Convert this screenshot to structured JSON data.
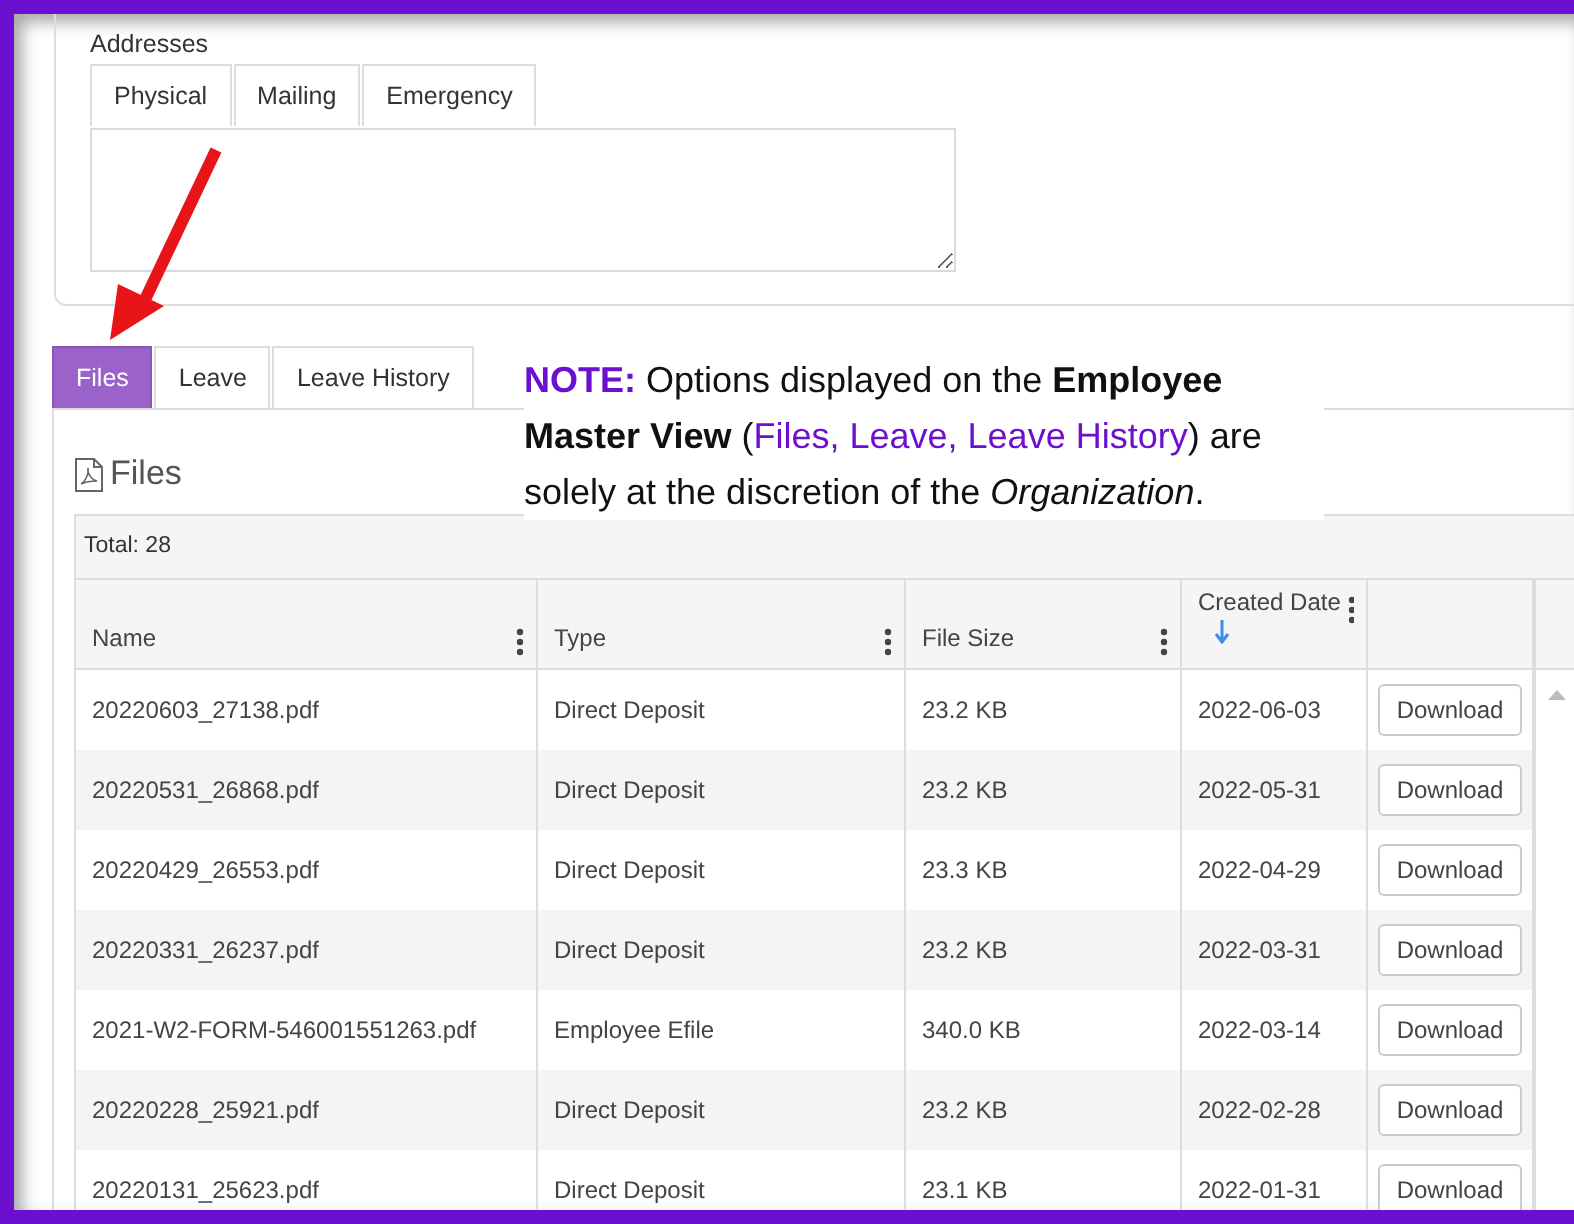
{
  "addresses": {
    "label": "Addresses",
    "tabs": [
      {
        "label": "Physical",
        "selected": false
      },
      {
        "label": "Mailing",
        "selected": false
      },
      {
        "label": "Emergency",
        "selected": false
      }
    ]
  },
  "tabs": [
    {
      "label": "Files",
      "selected": true
    },
    {
      "label": "Leave",
      "selected": false
    },
    {
      "label": "Leave History",
      "selected": false
    }
  ],
  "note": [
    {
      "text": "NOTE:",
      "kind": "label"
    },
    {
      "text": " Options displayed on the ",
      "kind": "plain"
    },
    {
      "text": "Employee Master View",
      "kind": "bold"
    },
    {
      "text": " (",
      "kind": "plain"
    },
    {
      "text": "Files, Leave, Leave History",
      "kind": "accent"
    },
    {
      "text": ") are solely at the discretion of the ",
      "kind": "plain"
    },
    {
      "text": "Organization",
      "kind": "italic"
    },
    {
      "text": ".",
      "kind": "plain"
    }
  ],
  "files": {
    "title": "Files",
    "total": "Total: 28",
    "columns": [
      {
        "label": "Name",
        "sorted": false
      },
      {
        "label": "Type",
        "sorted": false
      },
      {
        "label": "File Size",
        "sorted": false
      },
      {
        "label": "Created Date",
        "sorted": true
      }
    ],
    "rows": [
      {
        "name": "20220603_27138.pdf",
        "type": "Direct Deposit",
        "size": "23.2 KB",
        "date": "2022-06-03",
        "action": "Download"
      },
      {
        "name": "20220531_26868.pdf",
        "type": "Direct Deposit",
        "size": "23.2 KB",
        "date": "2022-05-31",
        "action": "Download"
      },
      {
        "name": "20220429_26553.pdf",
        "type": "Direct Deposit",
        "size": "23.3 KB",
        "date": "2022-04-29",
        "action": "Download"
      },
      {
        "name": "20220331_26237.pdf",
        "type": "Direct Deposit",
        "size": "23.2 KB",
        "date": "2022-03-31",
        "action": "Download"
      },
      {
        "name": "2021-W2-FORM-546001551263.pdf",
        "type": "Employee Efile",
        "size": "340.0 KB",
        "date": "2022-03-14",
        "action": "Download"
      },
      {
        "name": "20220228_25921.pdf",
        "type": "Direct Deposit",
        "size": "23.2 KB",
        "date": "2022-02-28",
        "action": "Download"
      },
      {
        "name": "20220131_25623.pdf",
        "type": "Direct Deposit",
        "size": "23.1 KB",
        "date": "2022-01-31",
        "action": "Download"
      }
    ]
  }
}
